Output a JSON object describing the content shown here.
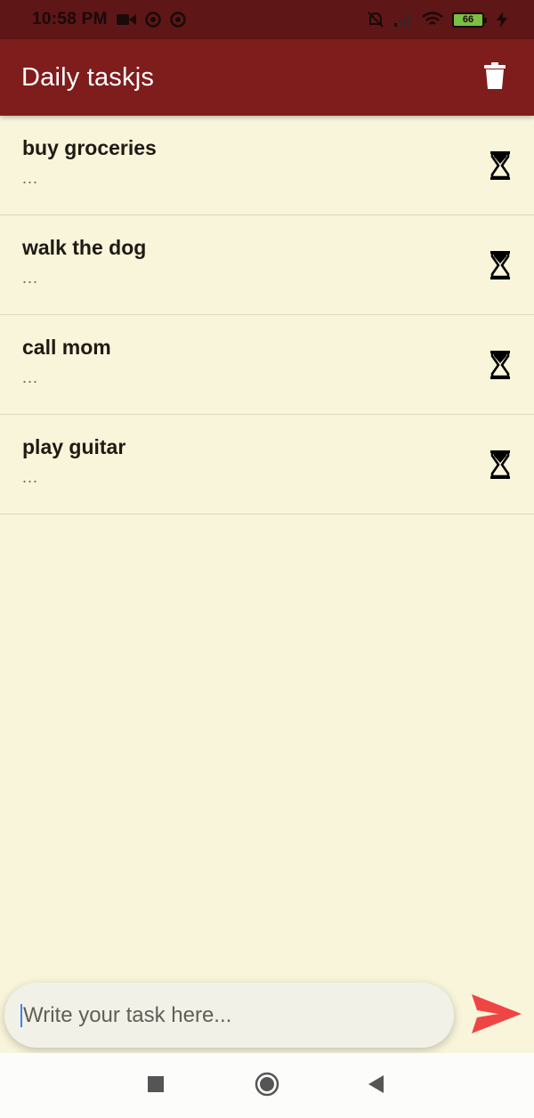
{
  "status_bar": {
    "time": "10:58 PM",
    "battery": "66",
    "icons": [
      "video-camera-icon",
      "sync-icon",
      "sync-icon",
      "silent-alarm-icon",
      "signal-icon",
      "wifi-icon",
      "battery-icon",
      "charging-icon"
    ]
  },
  "app_bar": {
    "title": "Daily taskjs",
    "action_icon": "trash-icon"
  },
  "tasks": [
    {
      "title": "buy groceries",
      "subtitle": "...",
      "status_icon": "hourglass-icon"
    },
    {
      "title": "walk the dog",
      "subtitle": "...",
      "status_icon": "hourglass-icon"
    },
    {
      "title": "call mom",
      "subtitle": "...",
      "status_icon": "hourglass-icon"
    },
    {
      "title": "play guitar",
      "subtitle": "...",
      "status_icon": "hourglass-icon"
    }
  ],
  "composer": {
    "placeholder": "Write your task here...",
    "value": "",
    "send_icon": "send-icon"
  },
  "nav_bar": {
    "buttons": [
      "recents-square-icon",
      "home-circle-icon",
      "back-triangle-icon"
    ]
  },
  "colors": {
    "app_bar": "#7f1c1c",
    "status_bar": "#5e1616",
    "background": "#f8f5da",
    "send": "#f04545"
  }
}
